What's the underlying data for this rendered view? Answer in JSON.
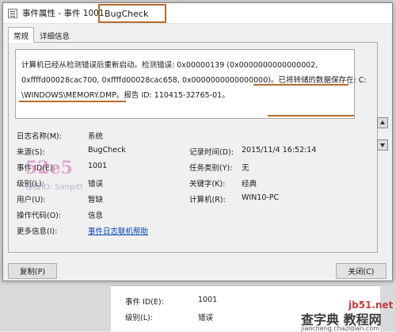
{
  "window": {
    "title": "事件属性 - 事件 1001",
    "title_highlight": "BugCheck"
  },
  "tabs": [
    {
      "label": "常规",
      "active": true
    },
    {
      "label": "详细信息",
      "active": false
    }
  ],
  "description": {
    "lines": [
      "计算机已经从检测错误后重新启动。检测错误: 0x00000139 (0x0000000000000002,",
      "0xffffd00028cac700, 0xffffd00028cac658, 0x0000000000000000)。已将转储的数据保存在: C:",
      "\\WINDOWS\\MEMORY.DMP。报告 ID: 110415-32765-01。"
    ]
  },
  "fields": {
    "log_name_label": "日志名称(M):",
    "log_name_value": "系统",
    "source_label": "来源(S):",
    "source_value": "BugCheck",
    "logged_label": "记录时间(D):",
    "logged_value": "2015/11/4 16:52:14",
    "event_id_label": "事件 ID(E):",
    "event_id_value": "1001",
    "task_label": "任务类别(Y):",
    "task_value": "无",
    "level_label": "级别(L):",
    "level_value": "错误",
    "keywords_label": "关键字(K):",
    "keywords_value": "经典",
    "user_label": "用户(U):",
    "user_value": "暂缺",
    "computer_label": "计算机(R):",
    "computer_value": "WIN10-PC",
    "opcode_label": "操作代码(O):",
    "opcode_value": "信息",
    "more_info_label": "更多信息(I):",
    "more_info_link": "事件日志联机帮助"
  },
  "buttons": {
    "copy": "复制(P)",
    "close": "关闭(C)"
  },
  "watermark": {
    "mark": "52e5",
    "text": "百度ID: Sanpitt"
  },
  "background": {
    "event_id_label": "事件 ID(E):",
    "event_id_value": "1001",
    "level_label": "级别(L):",
    "level_value": "错误"
  },
  "corner_watermark": {
    "line1": "jb51.net",
    "line2": "查字典 教程网",
    "line3": "jiaocheng.chazidian.com"
  }
}
